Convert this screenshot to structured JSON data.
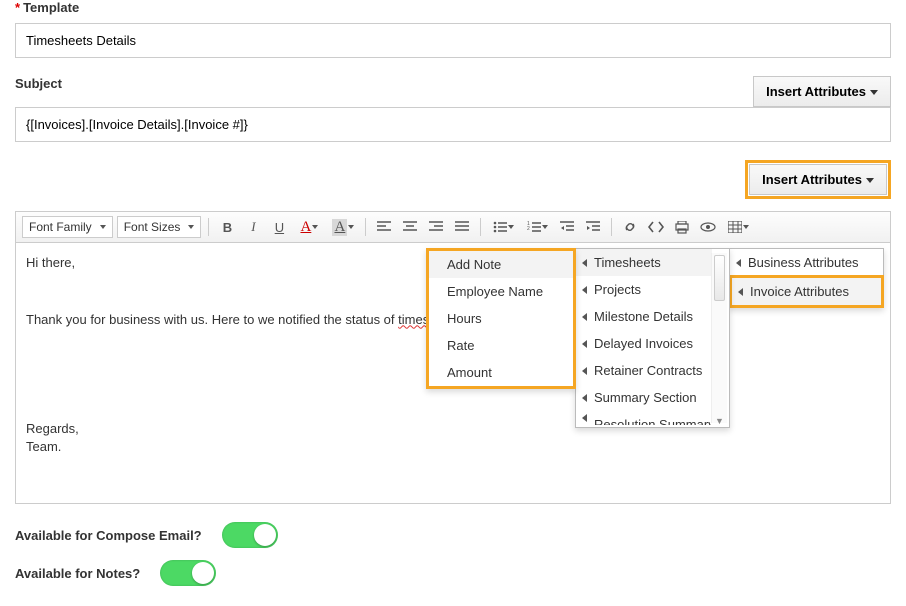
{
  "template": {
    "label": "Template",
    "value": "Timesheets Details"
  },
  "subject": {
    "label": "Subject",
    "value": "{[Invoices].[Invoice Details].[Invoice #]}"
  },
  "insert_attributes_label": "Insert Attributes",
  "toolbar": {
    "font_family": "Font Family",
    "font_sizes": "Font Sizes"
  },
  "body": {
    "greeting": "Hi there,",
    "line": "Thank you for business with us. Here to we notified the status of ",
    "squiggle": "timeshe",
    "regards": "Regards,",
    "team": "Team."
  },
  "menu1": {
    "business": "Business Attributes",
    "invoice": "Invoice Attributes"
  },
  "menu2": {
    "items": [
      "Timesheets",
      "Projects",
      "Milestone Details",
      "Delayed Invoices",
      "Retainer Contracts",
      "Summary Section",
      "Resolution Summary"
    ]
  },
  "menu3": {
    "items": [
      "Add Note",
      "Employee Name",
      "Hours",
      "Rate",
      "Amount"
    ]
  },
  "available": {
    "compose": "Available for Compose Email?",
    "notes": "Available for Notes?"
  }
}
